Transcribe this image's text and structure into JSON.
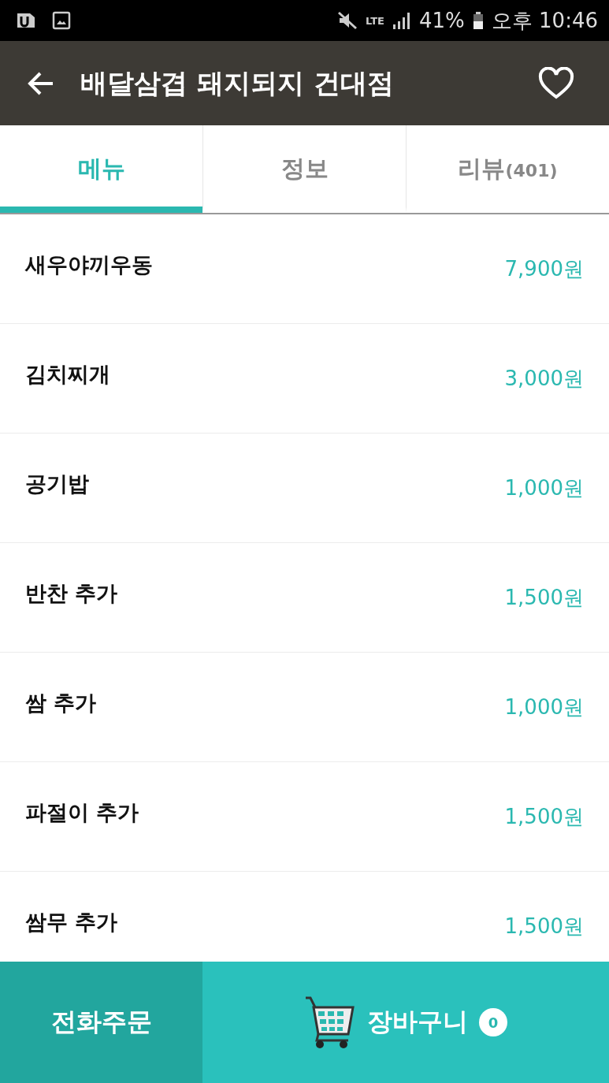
{
  "status_bar": {
    "network": "LTE",
    "battery": "41%",
    "time": "오후 10:46"
  },
  "header": {
    "title": "배달삼겹 돼지되지 건대점",
    "favorite": false
  },
  "tabs": [
    {
      "label": "메뉴",
      "selected": true
    },
    {
      "label": "정보",
      "selected": false
    },
    {
      "label": "리뷰",
      "count": "(401)",
      "selected": false
    }
  ],
  "menu_items": [
    {
      "name": "새우야끼우동",
      "price": "7,900원"
    },
    {
      "name": "김치찌개",
      "price": "3,000원"
    },
    {
      "name": "공기밥",
      "price": "1,000원"
    },
    {
      "name": "반찬 추가",
      "price": "1,500원"
    },
    {
      "name": "쌈 추가",
      "price": "1,000원"
    },
    {
      "name": "파절이 추가",
      "price": "1,500원"
    },
    {
      "name": "쌈무 추가",
      "price": "1,500원"
    }
  ],
  "bottom_bar": {
    "phone_order": "전화주문",
    "cart": "장바구니",
    "cart_count": "0"
  }
}
